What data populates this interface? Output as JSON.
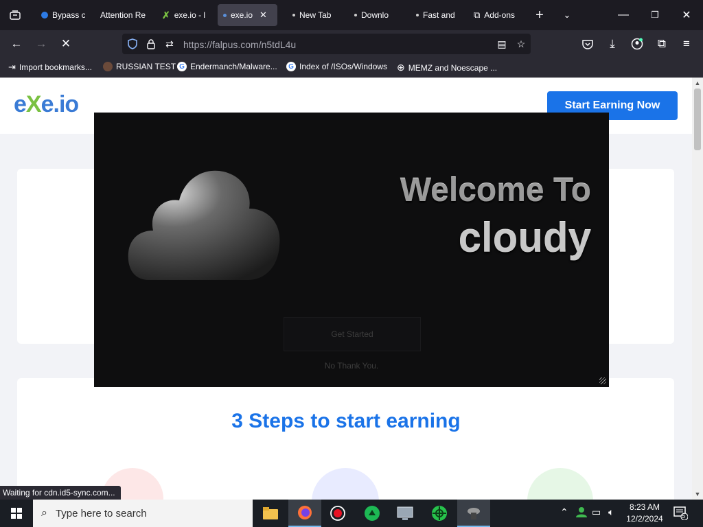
{
  "browser": {
    "tabs": [
      {
        "label": "Bypass c",
        "favicon": "blue-shield"
      },
      {
        "label": "Attention Re",
        "favicon": ""
      },
      {
        "label": "exe.io - l",
        "favicon": "exeio-logo"
      },
      {
        "label": "exe.io",
        "favicon": "dot",
        "active": true
      },
      {
        "label": "New Tab",
        "favicon": "dot"
      },
      {
        "label": "Downlo",
        "favicon": "dot"
      },
      {
        "label": "Fast and",
        "favicon": "dot"
      },
      {
        "label": "Add-ons",
        "favicon": "puzzle"
      }
    ],
    "url": "https://falpus.com/n5tdL4u",
    "bookmarks": [
      {
        "label": "Import bookmarks...",
        "icon": "import-icon"
      },
      {
        "label": "RUSSIAN TEST",
        "icon": "avatar-icon"
      },
      {
        "label": "Endermanch/Malware...",
        "icon": "google-icon"
      },
      {
        "label": "Index of /ISOs/Windows",
        "icon": "google-icon"
      },
      {
        "label": "MEMZ and Noescape ...",
        "icon": "globe-icon"
      }
    ],
    "status_text": "Waiting for cdn.id5-sync.com..."
  },
  "site": {
    "logo": {
      "e": "e",
      "x": "X",
      "rest": "e.io"
    },
    "cta_label": "Start Earning Now",
    "steps_title": "3 Steps to start earning"
  },
  "popup": {
    "welcome": "Welcome To",
    "name": "cloudy",
    "primary_button": "Get Started",
    "secondary_link": "No Thank You."
  },
  "taskbar": {
    "search_placeholder": "Type here to search",
    "time": "8:23 AM",
    "date": "12/2/2024",
    "notification_count": "5"
  },
  "colors": {
    "brand_blue": "#1a73e8",
    "exe_green": "#7ac142",
    "firefox_dark": "#1c1b22"
  }
}
